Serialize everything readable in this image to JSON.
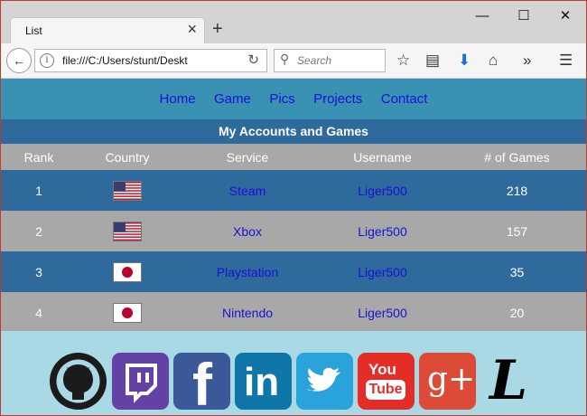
{
  "browser": {
    "tab_title": "List",
    "url": "file:///C:/Users/stunt/Deskt",
    "search_placeholder": "Search"
  },
  "nav": [
    "Home",
    "Game",
    "Pics",
    "Projects",
    "Contact"
  ],
  "table": {
    "caption": "My Accounts and Games",
    "headers": [
      "Rank",
      "Country",
      "Service",
      "Username",
      "# of Games"
    ],
    "rows": [
      {
        "rank": "1",
        "country": "us-flag",
        "service": "Steam",
        "username": "Liger500",
        "games": "218"
      },
      {
        "rank": "2",
        "country": "us-flag",
        "service": "Xbox",
        "username": "Liger500",
        "games": "157"
      },
      {
        "rank": "3",
        "country": "japan-flag",
        "service": "Playstation",
        "username": "Liger500",
        "games": "35"
      },
      {
        "rank": "4",
        "country": "japan-flag",
        "service": "Nintendo",
        "username": "Liger500",
        "games": "20"
      }
    ]
  },
  "social": {
    "youtube_text": [
      "You",
      "Tube"
    ],
    "googleplus_text": "g+",
    "death_note_text": "L",
    "linkedin_text": "in",
    "facebook_text": "f"
  },
  "colors": {
    "nav_bg": "#3991b3",
    "caption_bg": "#2e6a9c",
    "row_blue": "#2e6a9c",
    "row_gray": "#a8a8a8",
    "social_bg": "#aad9e6",
    "link": "#1a10d6"
  }
}
